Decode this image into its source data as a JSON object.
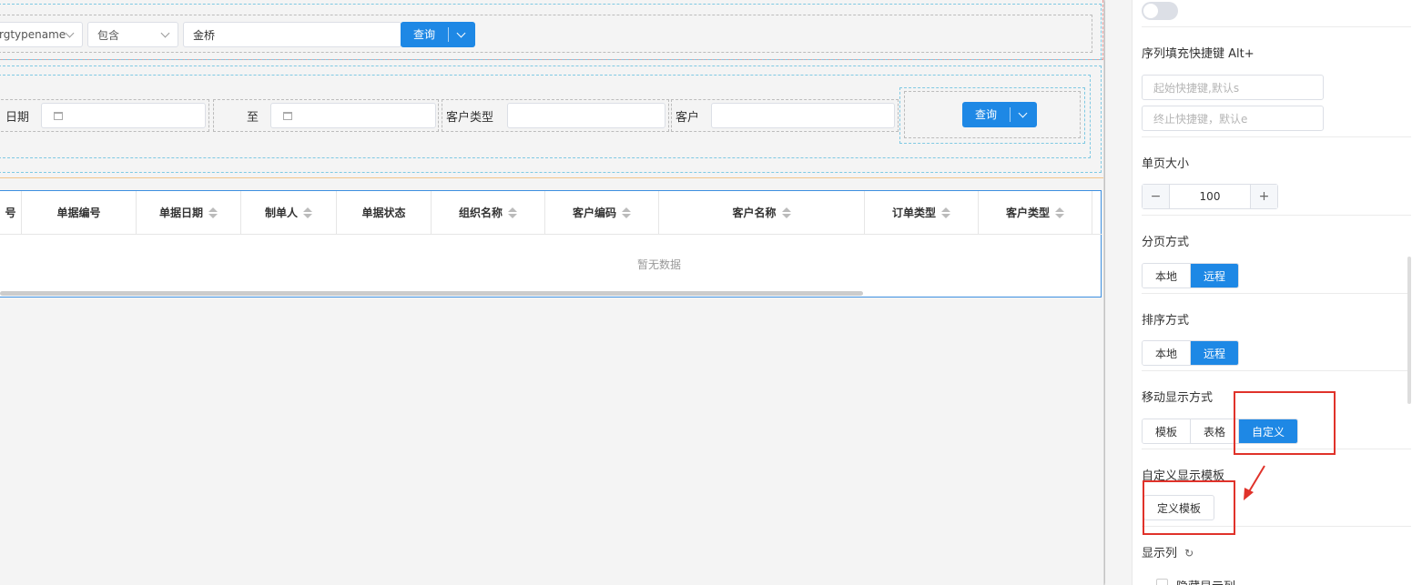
{
  "query_bar1": {
    "field_select": "rgtypename",
    "operator_select": "包含",
    "value_input": "金桥",
    "query_button": "查询"
  },
  "query_bar2": {
    "date_label": "日期",
    "to_label": "至",
    "customer_type_label": "客户类型",
    "customer_label": "客户",
    "query_button": "查询"
  },
  "table": {
    "columns": [
      {
        "label": "号",
        "sortable": false
      },
      {
        "label": "单据编号",
        "sortable": false
      },
      {
        "label": "单据日期",
        "sortable": true
      },
      {
        "label": "制单人",
        "sortable": true
      },
      {
        "label": "单据状态",
        "sortable": false
      },
      {
        "label": "组织名称",
        "sortable": true
      },
      {
        "label": "客户编码",
        "sortable": true
      },
      {
        "label": "客户名称",
        "sortable": true
      },
      {
        "label": "订单类型",
        "sortable": true
      },
      {
        "label": "客户类型",
        "sortable": true
      }
    ],
    "empty_text": "暂无数据"
  },
  "panel": {
    "seq_fill_title": "序列填充快捷键 Alt+",
    "start_placeholder": "起始快捷键,默认s",
    "end_placeholder": "终止快捷键，默认e",
    "page_size_title": "单页大小",
    "page_size_value": "100",
    "stepper_minus": "−",
    "stepper_plus": "+",
    "paging_title": "分页方式",
    "paging_options": [
      "本地",
      "远程"
    ],
    "paging_selected": "远程",
    "sort_title": "排序方式",
    "sort_options": [
      "本地",
      "远程"
    ],
    "sort_selected": "远程",
    "mobile_title": "移动显示方式",
    "mobile_options": [
      "模板",
      "表格",
      "自定义"
    ],
    "mobile_selected": "自定义",
    "custom_template_title": "自定义显示模板",
    "define_template_button": "定义模板",
    "display_columns_title": "显示列",
    "refresh_icon": "↻",
    "hide_columns_label": "隐藏显示列"
  },
  "colors": {
    "accent": "#1e88e5",
    "annotation_red": "#e0322a"
  }
}
